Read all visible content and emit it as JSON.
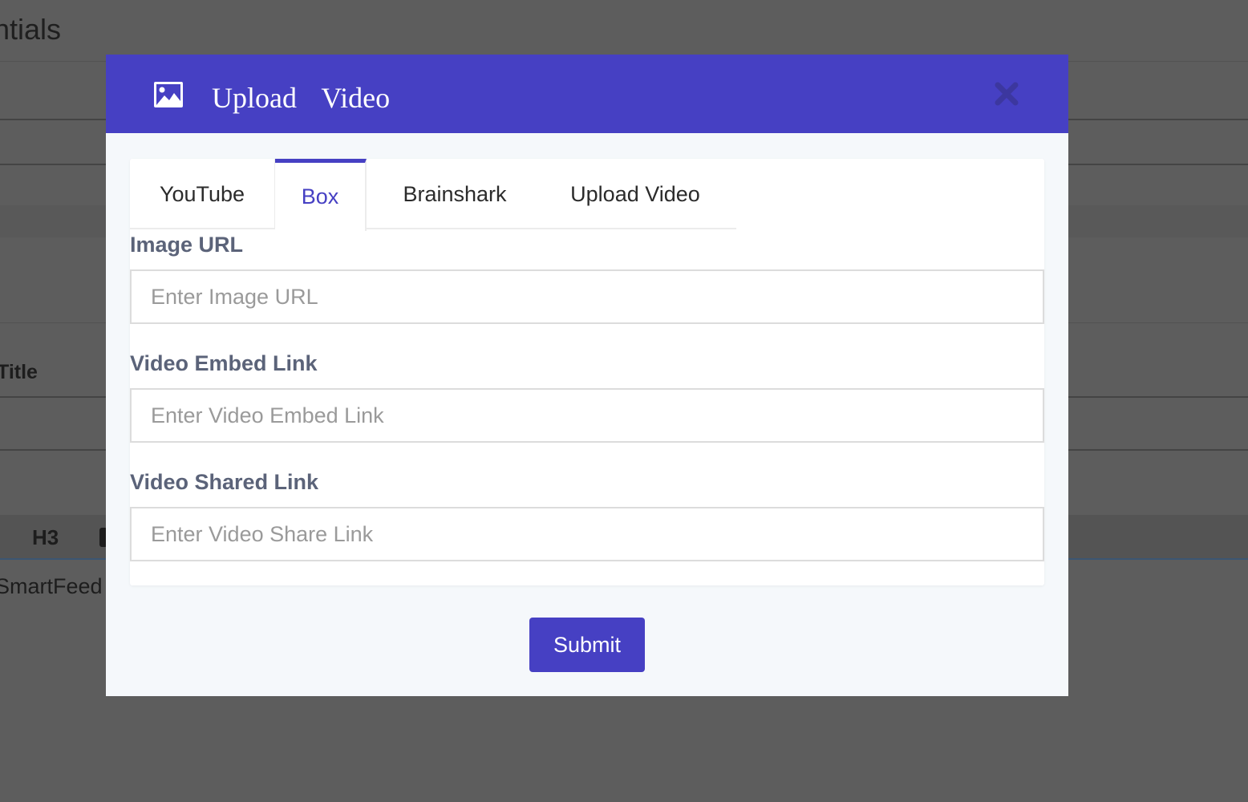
{
  "background": {
    "page_title": "ntials",
    "field_label": "Title",
    "toolbar_item": "H3",
    "body_text": "SmartFeed"
  },
  "modal": {
    "icon": "image-icon",
    "title": "Upload Video",
    "close_icon": "close-icon",
    "accent_color": "#4640c3",
    "tabs": [
      {
        "label": "YouTube",
        "active": false
      },
      {
        "label": "Box",
        "active": true
      },
      {
        "label": "Brainshark",
        "active": false
      },
      {
        "label": "Upload Video",
        "active": false
      }
    ],
    "fields": {
      "image_url": {
        "label": "Image URL",
        "placeholder": "Enter Image URL",
        "value": ""
      },
      "embed_link": {
        "label": "Video Embed Link",
        "placeholder": "Enter Video Embed Link",
        "value": ""
      },
      "share_link": {
        "label": "Video Shared Link",
        "placeholder": "Enter Video Share Link",
        "value": ""
      }
    },
    "submit_label": "Submit"
  }
}
